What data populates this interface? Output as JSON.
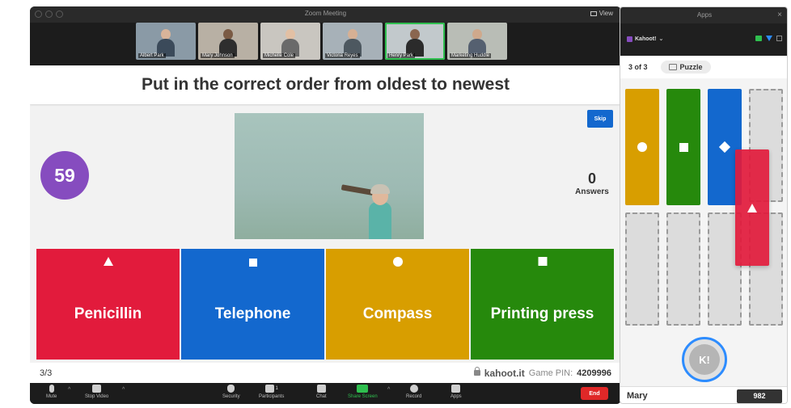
{
  "zoom": {
    "window_title": "Zoom Meeting",
    "view_label": "View",
    "participants": [
      {
        "name": "Albert Park",
        "active": false
      },
      {
        "name": "Mary Johnson",
        "active": false
      },
      {
        "name": "Michelle Cole",
        "active": false
      },
      {
        "name": "Victoria Reyes",
        "active": false
      },
      {
        "name": "Henry Park",
        "active": true
      },
      {
        "name": "Marketing Huddle",
        "active": false
      }
    ],
    "toolbar": {
      "mute": "Mute",
      "stop_video": "Stop Video",
      "security": "Security",
      "participants": "Participants",
      "participants_count": "1",
      "chat": "Chat",
      "share_screen": "Share Screen",
      "record": "Record",
      "apps": "Apps",
      "end": "End"
    }
  },
  "kahoot": {
    "question": "Put in the correct order from oldest to newest",
    "timer": "59",
    "skip_label": "Skip",
    "answers_count": "0",
    "answers_label": "Answers",
    "options": [
      {
        "label": "Penicillin",
        "shape": "triangle",
        "color": "#e21b3c"
      },
      {
        "label": "Telephone",
        "shape": "diamond",
        "color": "#1368ce"
      },
      {
        "label": "Compass",
        "shape": "circle",
        "color": "#d89e00"
      },
      {
        "label": "Printing press",
        "shape": "square",
        "color": "#26890c"
      }
    ],
    "footer": {
      "progress": "3/3",
      "brand": "kahoot.it",
      "pin_label": "Game PIN:",
      "pin": "4209996"
    }
  },
  "apps_panel": {
    "title": "Apps",
    "app_name": "Kahoot!",
    "progress": "3 of 3",
    "question_type": "Puzzle",
    "submit_label": "K!",
    "player_name": "Mary",
    "score": "982"
  }
}
